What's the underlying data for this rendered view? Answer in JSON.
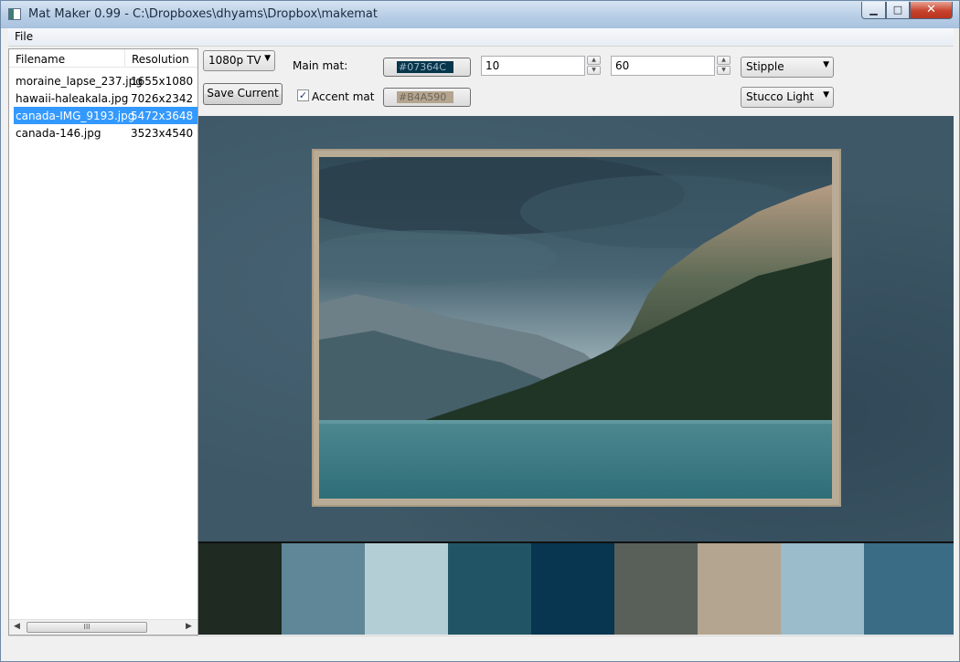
{
  "window": {
    "title": "Mat Maker 0.99 - C:\\Dropboxes\\dhyams\\Dropbox\\makemat"
  },
  "menu": {
    "file": "File"
  },
  "file_list": {
    "headers": {
      "filename": "Filename",
      "resolution": "Resolution"
    },
    "rows": [
      {
        "filename": "moraine_lapse_237.jpg",
        "resolution": "1655x1080"
      },
      {
        "filename": "hawaii-haleakala.jpg",
        "resolution": "7026x2342"
      },
      {
        "filename": "canada-IMG_9193.jpg",
        "resolution": "5472x3648"
      },
      {
        "filename": "canada-146.jpg",
        "resolution": "3523x4540"
      }
    ],
    "selected_index": 2,
    "scroll_thumb": "III"
  },
  "controls": {
    "preset": "1080p TV",
    "save_label": "Save Current",
    "main_mat_label": "Main mat:",
    "main_mat_color": "#07364C",
    "width_value": "10",
    "height_value": "60",
    "texture": "Stipple",
    "accent_mat_label": "Accent mat",
    "accent_checked": true,
    "accent_mat_color": "#B4A590",
    "finish": "Stucco Light"
  },
  "palette": [
    "#1e2a22",
    "#5f8797",
    "#b4ced6",
    "#215565",
    "#083650",
    "#59605a",
    "#b4a590",
    "#9abccb",
    "#3a6c85"
  ],
  "colors": {
    "selection": "#3399ff",
    "mat_background": "#3e5867"
  }
}
